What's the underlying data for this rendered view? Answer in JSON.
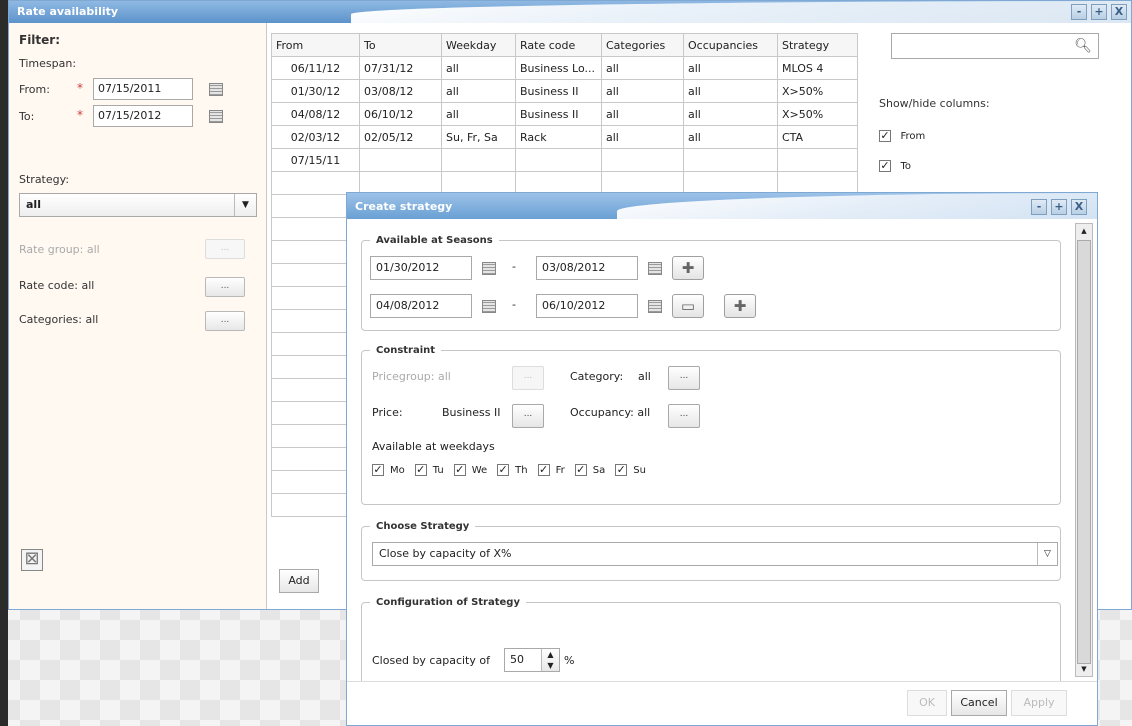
{
  "main_window": {
    "title": "Rate availability",
    "controls": [
      "-",
      "+",
      "X"
    ]
  },
  "filter": {
    "heading": "Filter:",
    "timespan_label": "Timespan:",
    "from_label": "From:",
    "from_value": "07/15/2011",
    "to_label": "To:",
    "to_value": "07/15/2012",
    "strategy_label": "Strategy:",
    "strategy_value": "all",
    "rate_group_label": "Rate group: all",
    "rate_code_label": "Rate code: all",
    "categories_label": "Categories: all",
    "dots": "..."
  },
  "table": {
    "columns": [
      "From",
      "To",
      "Weekday",
      "Rate code",
      "Categories",
      "Occupancies",
      "Strategy"
    ],
    "rows": [
      [
        "06/11/12",
        "07/31/12",
        "all",
        "Business Lo...",
        "all",
        "all",
        "MLOS 4"
      ],
      [
        "01/30/12",
        "03/08/12",
        "all",
        "Business II",
        "all",
        "all",
        "X>50%"
      ],
      [
        "04/08/12",
        "06/10/12",
        "all",
        "Business II",
        "all",
        "all",
        "X>50%"
      ],
      [
        "02/03/12",
        "02/05/12",
        "Su, Fr, Sa",
        "Rack",
        "all",
        "all",
        "CTA"
      ],
      [
        "07/15/11",
        "",
        "",
        "",
        "",
        "",
        ""
      ]
    ],
    "add_label": "Add"
  },
  "right_panel": {
    "show_hide_label": "Show/hide columns:",
    "columns": [
      "From",
      "To"
    ],
    "check": "✓"
  },
  "dialog": {
    "title": "Create strategy",
    "controls": [
      "-",
      "+",
      "X"
    ],
    "seasons_legend": "Available at Seasons",
    "season1_from": "01/30/2012",
    "season1_to": "03/08/2012",
    "season2_from": "04/08/2012",
    "season2_to": "06/10/2012",
    "dash": "-",
    "constraint_legend": "Constraint",
    "pricegroup_label": "Pricegroup: all",
    "category_label": "Category:",
    "category_value": "all",
    "price_label": "Price:",
    "price_value": "Business II",
    "occupancy_label": "Occupancy: all",
    "weekdays_label": "Available at weekdays",
    "weekdays": [
      "Mo",
      "Tu",
      "We",
      "Th",
      "Fr",
      "Sa",
      "Su"
    ],
    "choose_strategy_legend": "Choose Strategy",
    "strategy_value": "Close by capacity of X%",
    "config_legend": "Configuration of Strategy",
    "closed_by_label": "Closed by capacity of",
    "closed_by_value": "50",
    "percent": "%",
    "ok_label": "OK",
    "cancel_label": "Cancel",
    "apply_label": "Apply",
    "dots": "..."
  }
}
